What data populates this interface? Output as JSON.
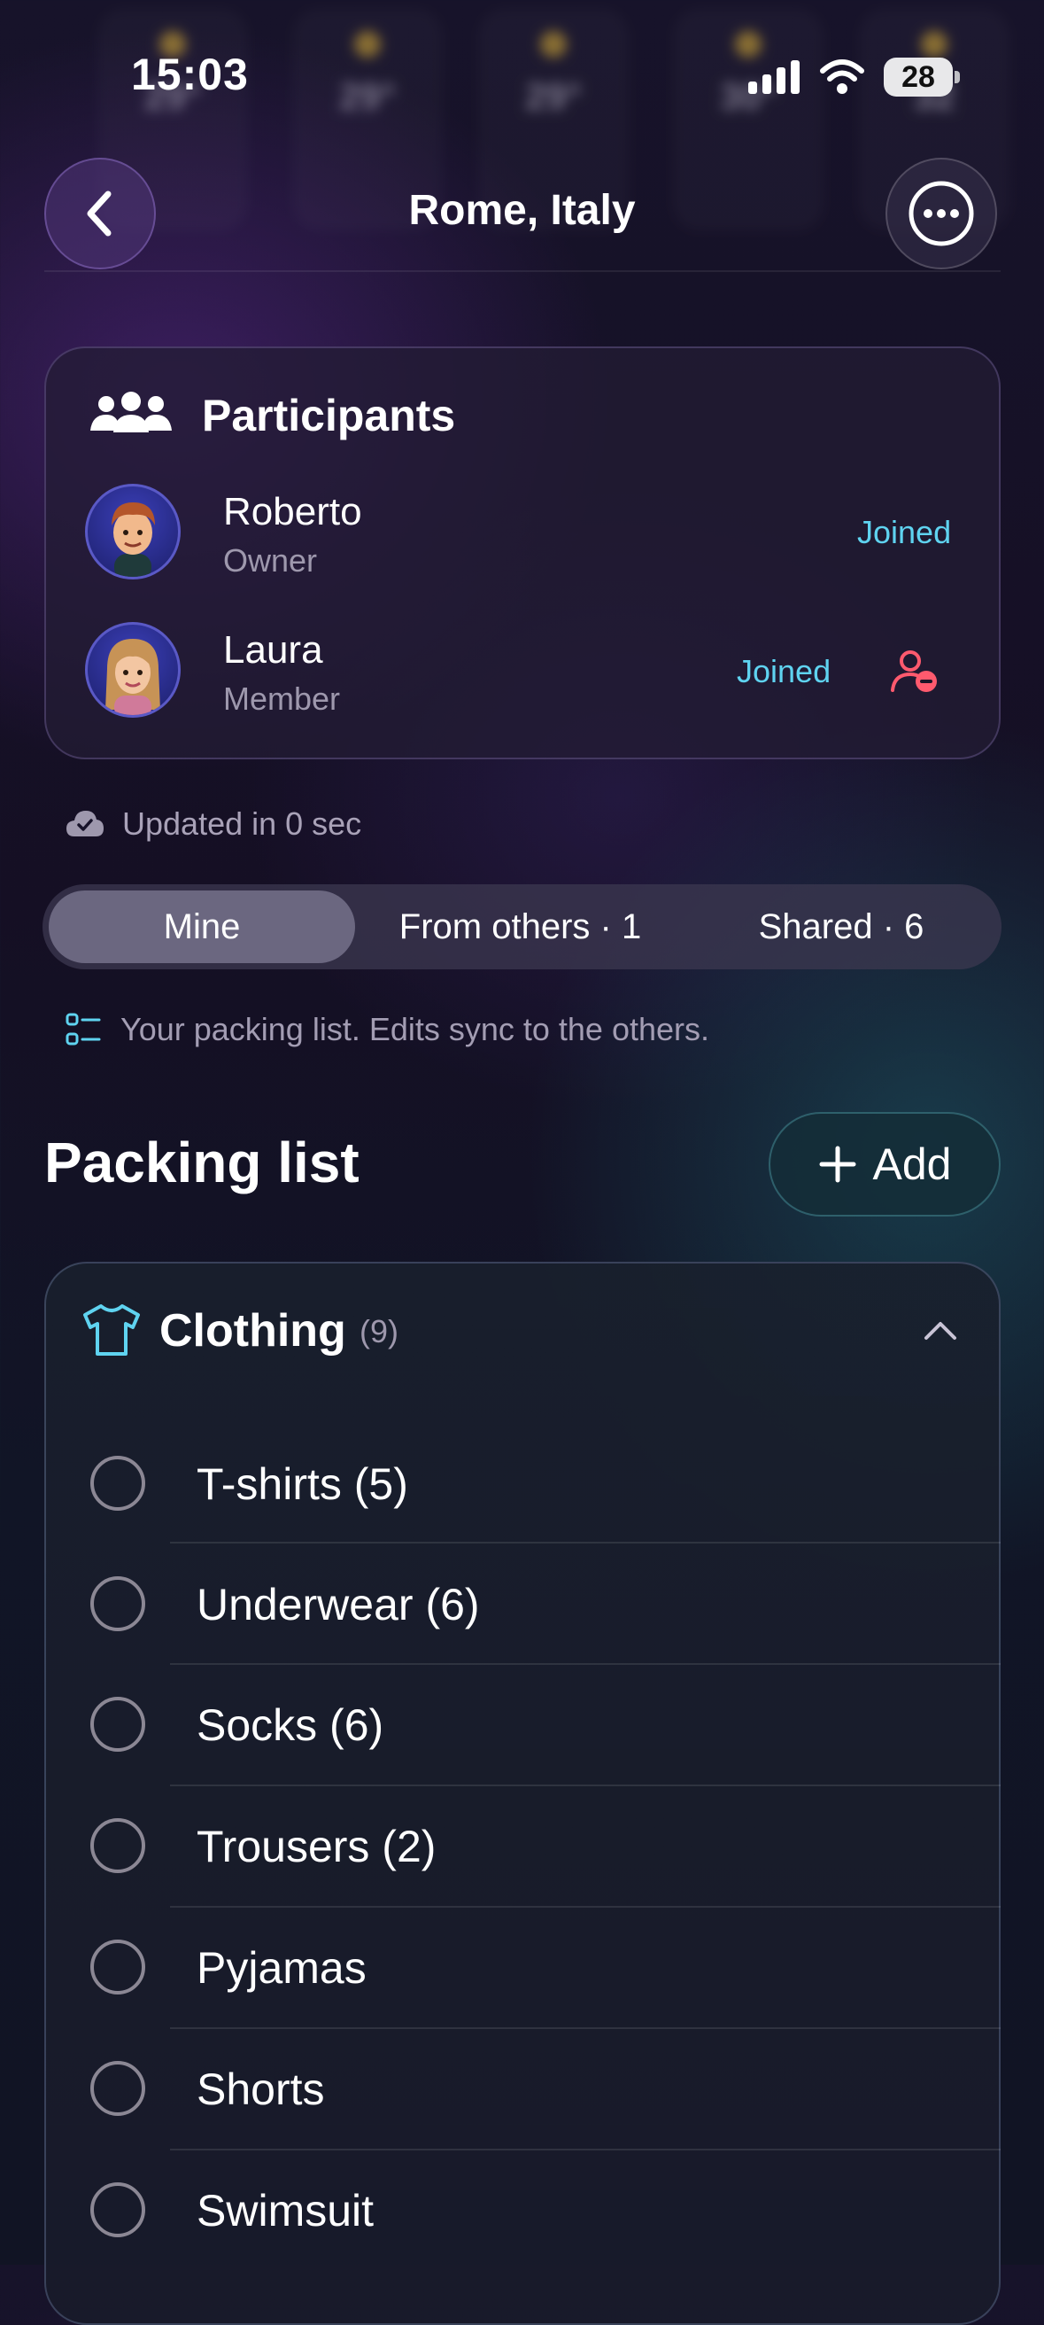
{
  "status_bar": {
    "time": "15:03",
    "battery": "28"
  },
  "weather_strip": {
    "temps": [
      "29°",
      "29°",
      "29°",
      "30°",
      "32"
    ]
  },
  "header": {
    "title": "Rome, Italy",
    "back_icon": "chevron-left-icon",
    "more_icon": "ellipsis-icon"
  },
  "participants": {
    "title": "Participants",
    "people": [
      {
        "name": "Roberto",
        "role": "Owner",
        "status": "Joined"
      },
      {
        "name": "Laura",
        "role": "Member",
        "status": "Joined"
      }
    ]
  },
  "sync": {
    "updated": "Updated in 0 sec"
  },
  "tabs": [
    {
      "label": "Mine",
      "active": true
    },
    {
      "label": "From others · 1",
      "active": false
    },
    {
      "label": "Shared · 6",
      "active": false
    }
  ],
  "hint": "Your packing list. Edits sync to the others.",
  "packing": {
    "title": "Packing list",
    "add_label": "Add",
    "category": {
      "name": "Clothing",
      "count": "(9)",
      "items": [
        "T-shirts (5)",
        "Underwear (6)",
        "Socks (6)",
        "Trousers (2)",
        "Pyjamas",
        "Shorts",
        "Swimsuit"
      ]
    }
  },
  "colors": {
    "accent_cyan": "#5fd3f0",
    "remove_red": "#ff5a6e"
  }
}
